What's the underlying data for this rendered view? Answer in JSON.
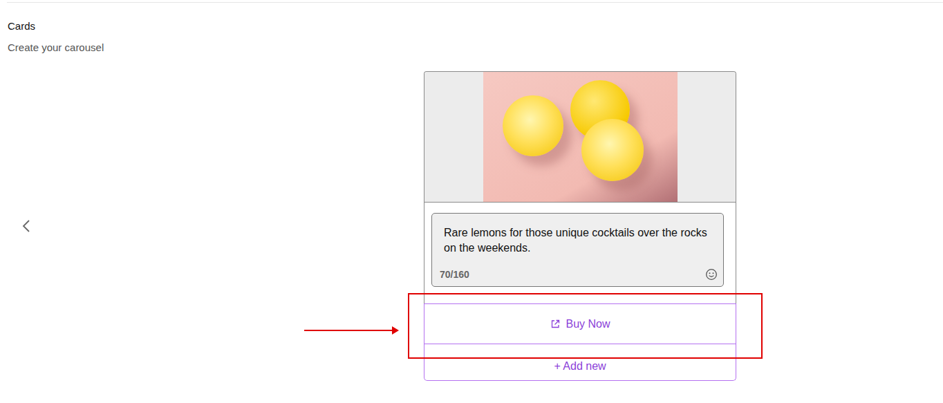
{
  "header": {
    "title": "Cards",
    "subtitle": "Create your carousel"
  },
  "card": {
    "description": "Rare lemons for those unique cocktails over the rocks on the weekends.",
    "counter": "70/160",
    "buttons": [
      {
        "label": "Buy Now",
        "kind": "link",
        "highlighted": true
      }
    ],
    "add_button": {
      "label": "+ Add new"
    }
  }
}
